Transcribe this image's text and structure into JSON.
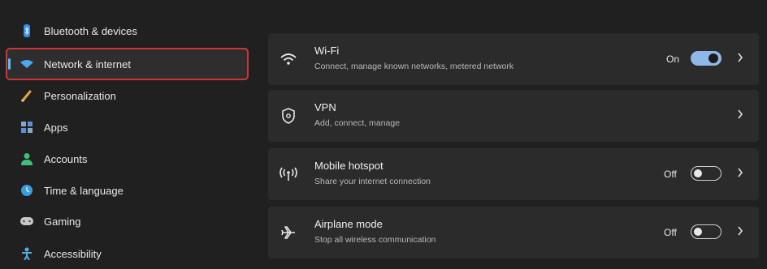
{
  "sidebar": {
    "items": [
      {
        "label": "Bluetooth & devices",
        "icon": "bluetooth-icon"
      },
      {
        "label": "Network & internet",
        "icon": "network-icon",
        "selected": true
      },
      {
        "label": "Personalization",
        "icon": "brush-icon"
      },
      {
        "label": "Apps",
        "icon": "apps-icon"
      },
      {
        "label": "Accounts",
        "icon": "person-icon"
      },
      {
        "label": "Time & language",
        "icon": "globe-clock-icon"
      },
      {
        "label": "Gaming",
        "icon": "controller-icon"
      },
      {
        "label": "Accessibility",
        "icon": "accessibility-icon"
      }
    ]
  },
  "main": {
    "cards": [
      {
        "title": "Wi-Fi",
        "subtitle": "Connect, manage known networks, metered network",
        "state": "On",
        "toggle": "on",
        "icon": "wifi-icon"
      },
      {
        "title": "VPN",
        "subtitle": "Add, connect, manage",
        "icon": "shield-icon"
      },
      {
        "title": "Mobile hotspot",
        "subtitle": "Share your internet connection",
        "state": "Off",
        "toggle": "off",
        "icon": "hotspot-icon"
      },
      {
        "title": "Airplane mode",
        "subtitle": "Stop all wireless communication",
        "state": "Off",
        "toggle": "off",
        "icon": "airplane-icon"
      }
    ]
  },
  "colors": {
    "accent": "#4cc2ff",
    "highlight_box": "#d0343a",
    "card_bg": "#2b2b2b",
    "page_bg": "#202020"
  }
}
